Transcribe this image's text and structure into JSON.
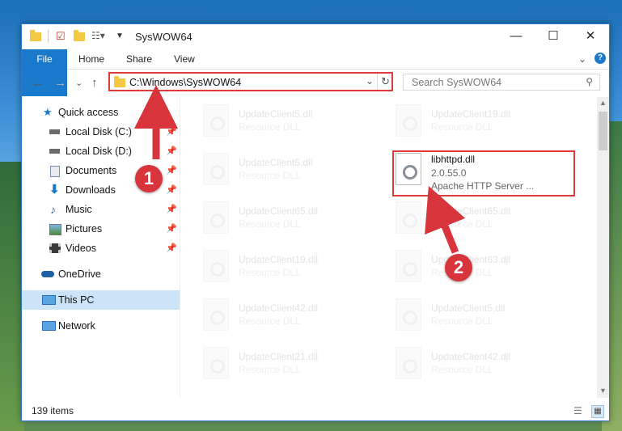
{
  "window": {
    "title": "SysWOW64",
    "minimize": "—",
    "maximize": "☐",
    "close": "✕"
  },
  "ribbon": {
    "tabs": [
      "File",
      "Home",
      "Share",
      "View"
    ],
    "collapse": "⌄",
    "help": "?"
  },
  "address": {
    "path": "C:\\Windows\\SysWOW64",
    "search_placeholder": "Search SysWOW64"
  },
  "nav": {
    "back": "←",
    "forward": "→",
    "recent": "⌄",
    "up": "↑"
  },
  "sidebar": {
    "items": [
      {
        "label": "Quick access",
        "icon": "star-icon"
      },
      {
        "label": "Local Disk (C:)",
        "icon": "drive-icon"
      },
      {
        "label": "Local Disk (D:)",
        "icon": "drive-icon"
      },
      {
        "label": "Documents",
        "icon": "document-icon"
      },
      {
        "label": "Downloads",
        "icon": "download-icon"
      },
      {
        "label": "Music",
        "icon": "music-icon"
      },
      {
        "label": "Pictures",
        "icon": "picture-icon"
      },
      {
        "label": "Videos",
        "icon": "video-icon"
      },
      {
        "label": "OneDrive",
        "icon": "cloud-icon"
      },
      {
        "label": "This PC",
        "icon": "computer-icon"
      },
      {
        "label": "Network",
        "icon": "network-icon"
      }
    ]
  },
  "files": [
    {
      "name": "UpdateClient5.dll",
      "desc": "Resource DLL"
    },
    {
      "name": "UpdateClient19.dll",
      "desc": "Resource DLL"
    },
    {
      "name": "UpdateClient5.dll",
      "desc": "Resource DLL"
    },
    {
      "name": "libhttpd.dll",
      "version": "2.0.55.0",
      "desc": "Apache HTTP Server ..."
    },
    {
      "name": "UpdateClient65.dll",
      "desc": "Resource DLL"
    },
    {
      "name": "UpdateClient65.dll",
      "desc": "Resource DLL"
    },
    {
      "name": "UpdateClient19.dll",
      "desc": "Resource DLL"
    },
    {
      "name": "UpdateClient63.dll",
      "desc": "Resource DLL"
    },
    {
      "name": "UpdateClient42.dll",
      "desc": "Resource DLL"
    },
    {
      "name": "UpdateClient5.dll",
      "desc": "Resource DLL"
    },
    {
      "name": "UpdateClient21.dll",
      "desc": "Resource DLL"
    },
    {
      "name": "UpdateClient42.dll",
      "desc": "Resource DLL"
    }
  ],
  "status": {
    "count": "139 items"
  },
  "callouts": {
    "one": "1",
    "two": "2"
  },
  "colors": {
    "accent": "#1979ca",
    "highlight": "#e03a3a",
    "selected": "#cce4f7"
  }
}
